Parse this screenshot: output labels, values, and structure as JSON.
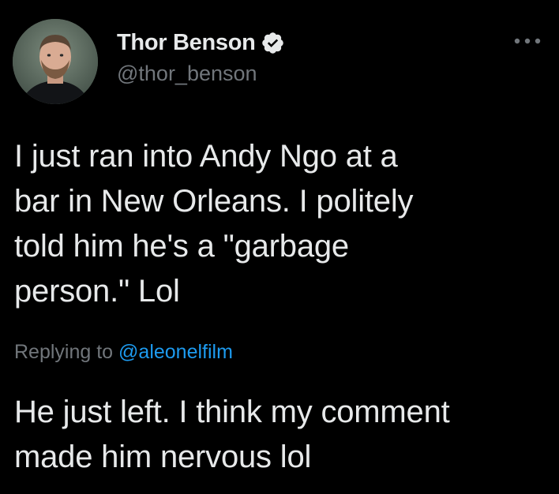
{
  "author": {
    "display_name": "Thor Benson",
    "handle": "@thor_benson",
    "verified": true
  },
  "tweet": {
    "text": "I just ran into Andy Ngo at a\nbar in New Orleans. I politely\ntold him he's a \"garbage\nperson.\" Lol",
    "reply_prefix": "Replying to ",
    "reply_to": "@aleonelfilm",
    "reply_text": "He just left. I think my comment\nmade him nervous lol"
  },
  "icons": {
    "verified": "verified-badge-icon",
    "more": "more-options-icon"
  },
  "colors": {
    "background": "#000000",
    "text": "#e7e9ea",
    "secondary": "#71767b",
    "link": "#1d9bf0"
  }
}
